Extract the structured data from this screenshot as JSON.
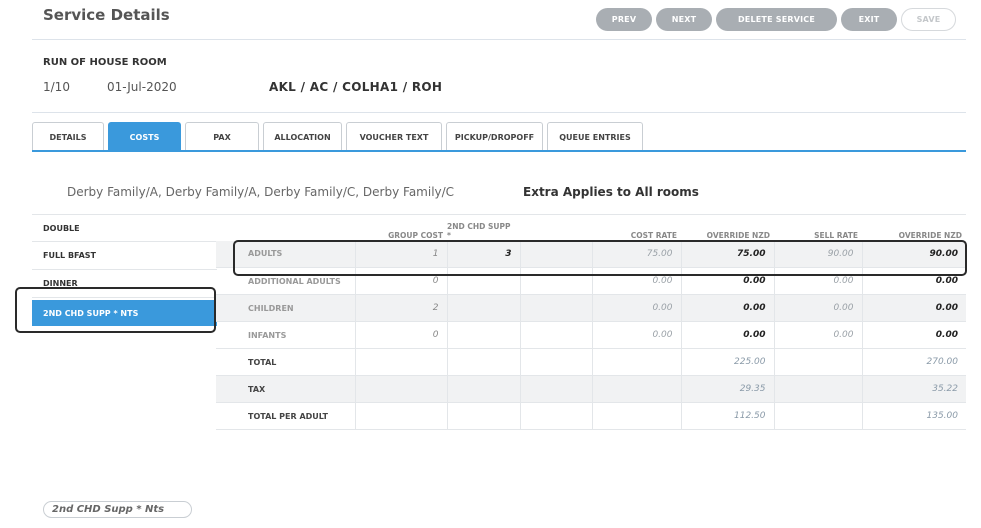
{
  "header": {
    "title": "Service Details"
  },
  "toolbar": {
    "prev": "PREV",
    "next": "NEXT",
    "delete": "DELETE SERVICE",
    "exit": "EXIT",
    "save": "SAVE"
  },
  "room": {
    "name": "RUN OF HOUSE ROOM",
    "index": "1/10",
    "date": "01-Jul-2020",
    "code": "AKL / AC / COLHA1 / ROH"
  },
  "tabs": [
    {
      "label": "DETAILS"
    },
    {
      "label": "COSTS",
      "active": true
    },
    {
      "label": "PAX"
    },
    {
      "label": "ALLOCATION"
    },
    {
      "label": "VOUCHER TEXT"
    },
    {
      "label": "PICKUP/DROPOFF"
    },
    {
      "label": "QUEUE ENTRIES"
    }
  ],
  "pax": {
    "names": "Derby Family/A, Derby Family/A, Derby Family/C, Derby Family/C",
    "extra_applies": "Extra Applies to All rooms"
  },
  "extras": [
    {
      "label": "DOUBLE"
    },
    {
      "label": "FULL BFAST"
    },
    {
      "label": "DINNER"
    },
    {
      "label": "2ND CHD SUPP * NTS",
      "selected": true
    }
  ],
  "costs": {
    "headers": [
      "",
      "GROUP COST",
      "2ND CHD SUPP *",
      "",
      "COST RATE",
      "OVERRIDE NZD",
      "SELL RATE",
      "OVERRIDE NZD"
    ],
    "rows": [
      {
        "label": "ADULTS",
        "group_cost": "1",
        "chd_supp": "3",
        "blank": "",
        "cost_rate": "75.00",
        "override_cost": "75.00",
        "sell_rate": "90.00",
        "override_sell": "90.00"
      },
      {
        "label": "ADDITIONAL ADULTS",
        "group_cost": "0",
        "chd_supp": "",
        "blank": "",
        "cost_rate": "0.00",
        "override_cost": "0.00",
        "sell_rate": "0.00",
        "override_sell": "0.00"
      },
      {
        "label": "CHILDREN",
        "group_cost": "2",
        "chd_supp": "",
        "blank": "",
        "cost_rate": "0.00",
        "override_cost": "0.00",
        "sell_rate": "0.00",
        "override_sell": "0.00"
      },
      {
        "label": "INFANTS",
        "group_cost": "0",
        "chd_supp": "",
        "blank": "",
        "cost_rate": "0.00",
        "override_cost": "0.00",
        "sell_rate": "0.00",
        "override_sell": "0.00"
      },
      {
        "label": "TOTAL",
        "override_cost": "225.00",
        "override_sell": "270.00"
      },
      {
        "label": "TAX",
        "override_cost": "29.35",
        "override_sell": "35.22"
      },
      {
        "label": "TOTAL PER ADULT",
        "override_cost": "112.50",
        "override_sell": "135.00"
      }
    ]
  },
  "footer": {
    "pill": "2nd CHD Supp * Nts"
  },
  "colors": {
    "accent": "#3a99dc",
    "button_gray": "#a9aeb3"
  }
}
